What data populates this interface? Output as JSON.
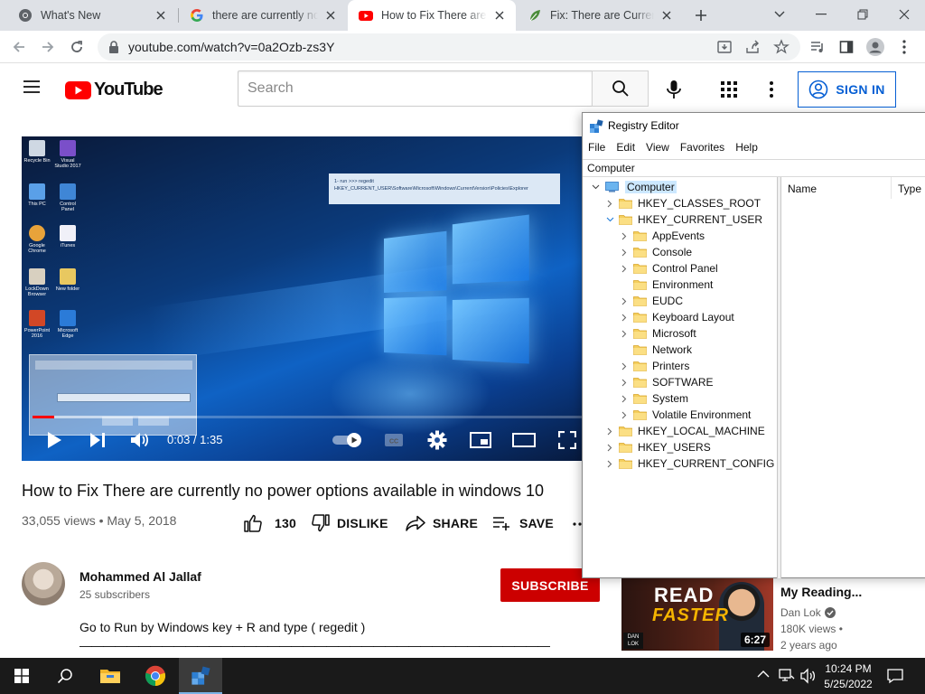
{
  "browser": {
    "tabs": [
      {
        "title": "What's New",
        "active": false
      },
      {
        "title": "there are currently no power options available",
        "active": false
      },
      {
        "title": "How to Fix There are currently no power options",
        "active": true
      },
      {
        "title": "Fix: There are Currently No Power Options",
        "active": false
      }
    ],
    "url": "youtube.com/watch?v=0a2Ozb-zs3Y"
  },
  "youtube": {
    "logo_text": "YouTube",
    "search_placeholder": "Search",
    "sign_in_label": "SIGN IN",
    "player": {
      "time_current": "0:03",
      "time_total": "1:35",
      "time_display": "0:03 / 1:35",
      "progress_fraction": 0.04,
      "note_line1": "1- run >>> regedit",
      "note_line2": "HKEY_CURRENT_USER\\Software\\Microsoft\\Windows\\CurrentVersion\\Policies\\Explorer",
      "desktop_icons": [
        "Recycle Bin",
        "Visual Studio 2017",
        "This PC",
        "Control Panel",
        "Google Chrome",
        "iTunes",
        "LockDown Browser",
        "New folder",
        "PowerPoint 2016",
        "Microsoft Edge"
      ]
    },
    "video": {
      "title": "How to Fix There are currently no power options available in windows 10",
      "stats": "33,055 views • May 5, 2018",
      "likes": "130",
      "dislike_label": "DISLIKE",
      "share_label": "SHARE",
      "save_label": "SAVE"
    },
    "channel": {
      "name": "Mohammed Al Jallaf",
      "subscribers": "25 subscribers",
      "subscribe_label": "SUBSCRIBE"
    },
    "description": {
      "line1": "Go to Run by Windows key + R and type ( regedit )",
      "line2": "————————————————————————————————————————"
    },
    "related": {
      "title": "My Reading...",
      "channel": "Dan Lok",
      "views": "180K views •",
      "age": "2 years ago",
      "duration": "6:27",
      "thumb_text1": "READ",
      "thumb_text2": "FASTER",
      "thumb_brand": "DAN LOK"
    }
  },
  "regedit": {
    "title": "Registry Editor",
    "menu": [
      "File",
      "Edit",
      "View",
      "Favorites",
      "Help"
    ],
    "address": "Computer",
    "columns": [
      "Name",
      "Type"
    ],
    "tree": [
      {
        "label": "Computer",
        "level": 0,
        "chevron": "down",
        "selected": true,
        "icon": "computer"
      },
      {
        "label": "HKEY_CLASSES_ROOT",
        "level": 1,
        "chevron": "right"
      },
      {
        "label": "HKEY_CURRENT_USER",
        "level": 1,
        "chevron": "down"
      },
      {
        "label": "AppEvents",
        "level": 2,
        "chevron": "right"
      },
      {
        "label": "Console",
        "level": 2,
        "chevron": "right"
      },
      {
        "label": "Control Panel",
        "level": 2,
        "chevron": "right"
      },
      {
        "label": "Environment",
        "level": 2,
        "chevron": "none"
      },
      {
        "label": "EUDC",
        "level": 2,
        "chevron": "right"
      },
      {
        "label": "Keyboard Layout",
        "level": 2,
        "chevron": "right"
      },
      {
        "label": "Microsoft",
        "level": 2,
        "chevron": "right"
      },
      {
        "label": "Network",
        "level": 2,
        "chevron": "none"
      },
      {
        "label": "Printers",
        "level": 2,
        "chevron": "right"
      },
      {
        "label": "SOFTWARE",
        "level": 2,
        "chevron": "right"
      },
      {
        "label": "System",
        "level": 2,
        "chevron": "right"
      },
      {
        "label": "Volatile Environment",
        "level": 2,
        "chevron": "right"
      },
      {
        "label": "HKEY_LOCAL_MACHINE",
        "level": 1,
        "chevron": "right"
      },
      {
        "label": "HKEY_USERS",
        "level": 1,
        "chevron": "right"
      },
      {
        "label": "HKEY_CURRENT_CONFIG",
        "level": 1,
        "chevron": "right"
      }
    ]
  },
  "taskbar": {
    "time": "10:24 PM",
    "date": "5/25/2022",
    "apps": [
      "file-explorer",
      "chrome",
      "registry-editor"
    ]
  },
  "colors": {
    "youtube_red": "#ff0000",
    "subscribe_red": "#cc0000",
    "link_blue": "#065fd4",
    "taskbar": "#1a1a1a",
    "tab_strip": "#dee1e6"
  }
}
